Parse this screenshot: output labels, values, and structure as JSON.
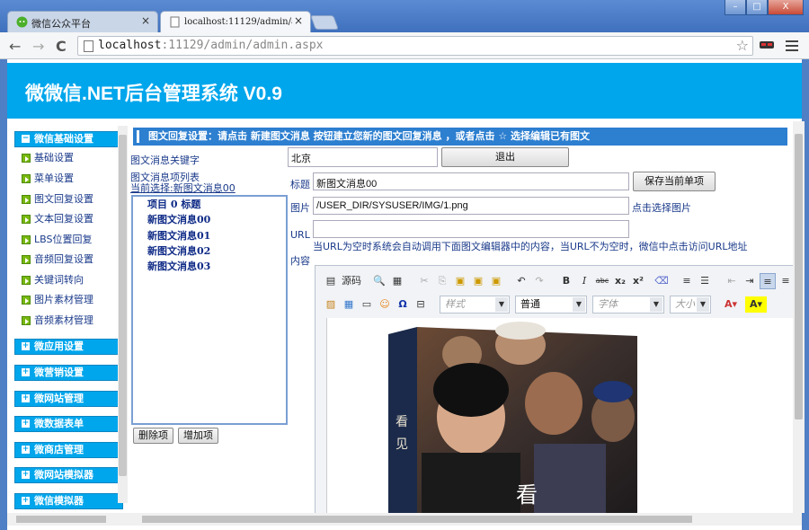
{
  "browser": {
    "tabs": [
      {
        "label": "微信公众平台",
        "close": "×"
      },
      {
        "label": "localhost:11129/admin/a",
        "close": "×"
      }
    ],
    "url": "localhost:11129/admin/admin.aspx",
    "url_host": "localhost",
    "url_rest": ":11129/admin/admin.aspx",
    "window_buttons": [
      "–",
      "□",
      "X"
    ],
    "nav": {
      "back": "←",
      "forward": "→",
      "reload": "C"
    }
  },
  "header": {
    "title": "微微信.NET后台管理系统 V0.9"
  },
  "sidebar": {
    "open_group": "微信基础设置",
    "items": [
      "基础设置",
      "菜单设置",
      "图文回复设置",
      "文本回复设置",
      "LBS位置回复",
      "音频回复设置",
      "关键词转向",
      "图片素材管理",
      "音频素材管理"
    ],
    "groups": [
      "微应用设置",
      "微营销设置",
      "微网站管理",
      "微数据表单",
      "微商店管理",
      "微网站模拟器",
      "微信模拟器"
    ]
  },
  "main": {
    "section_title": "图文回复设置：请点击 新建图文消息 按钮建立您新的图文回复消息 ，或者点击 ☆ 选择编辑已有图文",
    "keyword_label": "图文消息关键字",
    "keyword_value": "北京",
    "exit_button": "退出",
    "list_label": "图文消息项列表",
    "current_selection": "当前选择:新图文消息00",
    "list_items": [
      "项目 0 标题",
      "新图文消息00",
      "新图文消息01",
      "新图文消息02",
      "新图文消息03"
    ],
    "delete_button": "删除项",
    "add_button": "增加项",
    "title_label": "标题",
    "title_value": "新图文消息00",
    "save_button": "保存当前单项",
    "image_label": "图片",
    "image_value": "/USER_DIR/SYSUSER/IMG/1.png",
    "choose_image_link": "点击选择图片",
    "url_label": "URL",
    "url_value": "",
    "url_hint": "当URL为空时系统会自动调用下面图文编辑器中的内容，当URL不为空时，微信中点击访问URL地址",
    "content_label": "内容"
  },
  "editor": {
    "source_label": "源码",
    "style_placeholder": "样式",
    "format_value": "普通",
    "font_placeholder": "字体",
    "size_placeholder": "大小",
    "image_text": [
      "看",
      "见",
      "看"
    ]
  },
  "colors": {
    "header_bg": "#00a6ec",
    "section_bg": "#2d7fd0",
    "link": "#1a3a8a"
  }
}
